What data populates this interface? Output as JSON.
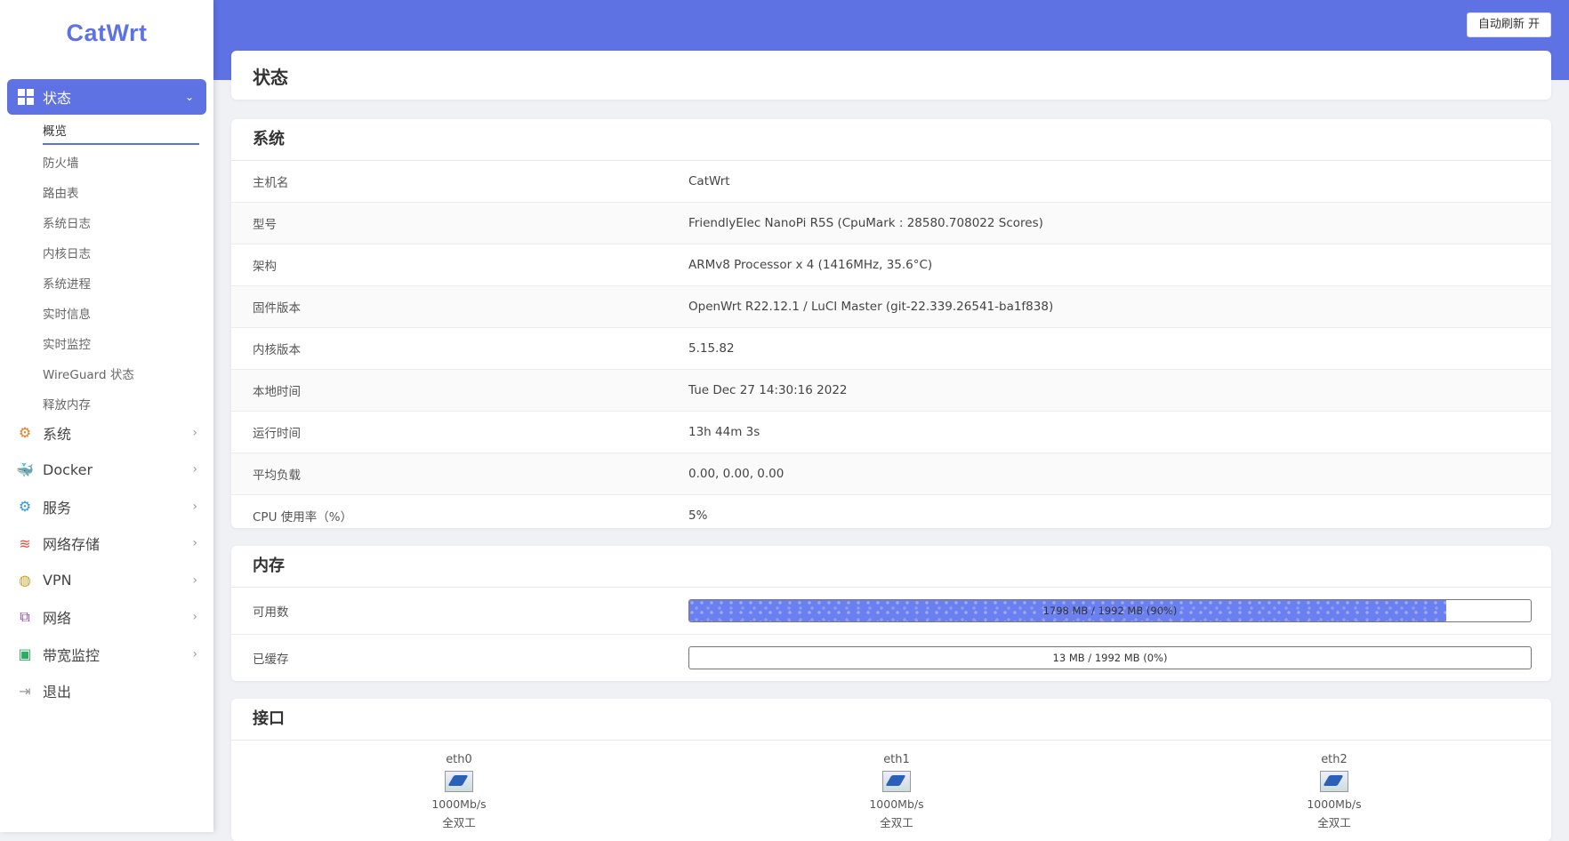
{
  "brand": "CatWrt",
  "menu_active": {
    "label": "状态"
  },
  "submenu": [
    "概览",
    "防火墙",
    "路由表",
    "系统日志",
    "内核日志",
    "系统进程",
    "实时信息",
    "实时监控",
    "WireGuard 状态",
    "释放内存"
  ],
  "menu": [
    {
      "label": "系统",
      "icon": "gear-icon",
      "color": "#e67e22"
    },
    {
      "label": "Docker",
      "icon": "docker-icon",
      "color": "#2496ed"
    },
    {
      "label": "服务",
      "icon": "gears-icon",
      "color": "#3498db"
    },
    {
      "label": "网络存储",
      "icon": "database-icon",
      "color": "#e74c3c"
    },
    {
      "label": "VPN",
      "icon": "globe-icon",
      "color": "#c9a227"
    },
    {
      "label": "网络",
      "icon": "network-icon",
      "color": "#8e44ad"
    },
    {
      "label": "带宽监控",
      "icon": "monitor-icon",
      "color": "#27ae60"
    },
    {
      "label": "退出",
      "icon": "logout-icon",
      "color": "#999999"
    }
  ],
  "header": {
    "refresh_label": "自动刷新 开"
  },
  "page": {
    "title": "状态"
  },
  "system": {
    "title": "系统",
    "rows": [
      {
        "k": "主机名",
        "v": "CatWrt"
      },
      {
        "k": "型号",
        "v": "FriendlyElec NanoPi R5S (CpuMark : 28580.708022 Scores)"
      },
      {
        "k": "架构",
        "v": "ARMv8 Processor x 4 (1416MHz, 35.6°C)"
      },
      {
        "k": "固件版本",
        "v": "OpenWrt R22.12.1 / LuCI Master (git-22.339.26541-ba1f838)"
      },
      {
        "k": "内核版本",
        "v": "5.15.82"
      },
      {
        "k": "本地时间",
        "v": "Tue Dec 27 14:30:16 2022"
      },
      {
        "k": "运行时间",
        "v": "13h 44m 3s"
      },
      {
        "k": "平均负载",
        "v": "0.00, 0.00, 0.00"
      },
      {
        "k": "CPU 使用率（%）",
        "v": "5%"
      }
    ]
  },
  "memory": {
    "title": "内存",
    "rows": [
      {
        "k": "可用数",
        "v": "1798 MB / 1992 MB (90%)",
        "fraction": 0.9
      },
      {
        "k": "已缓存",
        "v": "13 MB / 1992 MB (0%)",
        "fraction": 0.0
      }
    ]
  },
  "interfaces": {
    "title": "接口",
    "items": [
      {
        "name": "eth0",
        "speed": "1000Mb/s",
        "duplex": "全双工"
      },
      {
        "name": "eth1",
        "speed": "1000Mb/s",
        "duplex": "全双工"
      },
      {
        "name": "eth2",
        "speed": "1000Mb/s",
        "duplex": "全双工"
      }
    ]
  }
}
